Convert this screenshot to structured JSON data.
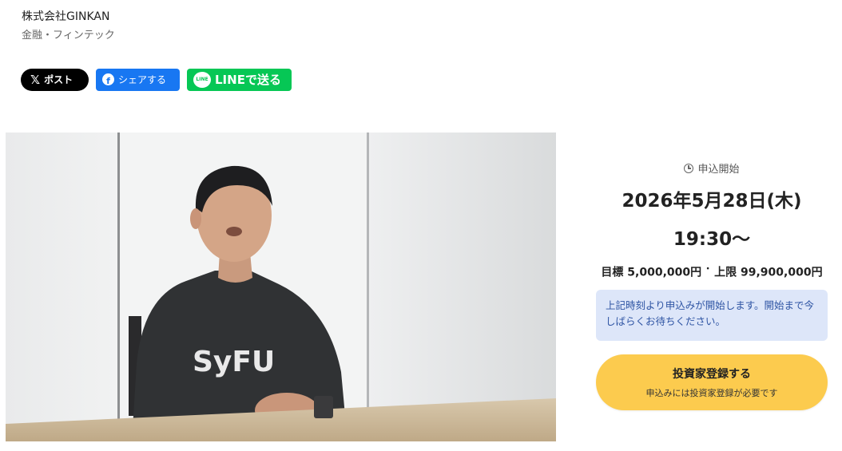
{
  "company": {
    "name": "株式会社GINKAN",
    "category": "金融・フィンテック"
  },
  "share": {
    "x_label": "ポスト",
    "facebook_label": "シェアする",
    "line_label": "LINEで送る",
    "line_badge": "LINE"
  },
  "photo": {
    "shirt_logo_text": "SyFU"
  },
  "offering": {
    "status_label": "申込開始",
    "date": "2026年5月28日(木)",
    "time": "19:30〜",
    "target_amount": "目標 5,000,000円",
    "amount_separator": "・",
    "max_amount": "上限 99,900,000円",
    "notice": "上記時刻より申込みが開始します。開始まで今しばらくお待ちください。",
    "register_title": "投資家登録する",
    "register_sub": "申込みには投資家登録が必要です"
  },
  "colors": {
    "x_bg": "#000000",
    "facebook_bg": "#1877f2",
    "line_bg": "#06c755",
    "notice_bg": "#dde6f9",
    "notice_text": "#2f55a4",
    "register_bg": "#fccb4e"
  }
}
